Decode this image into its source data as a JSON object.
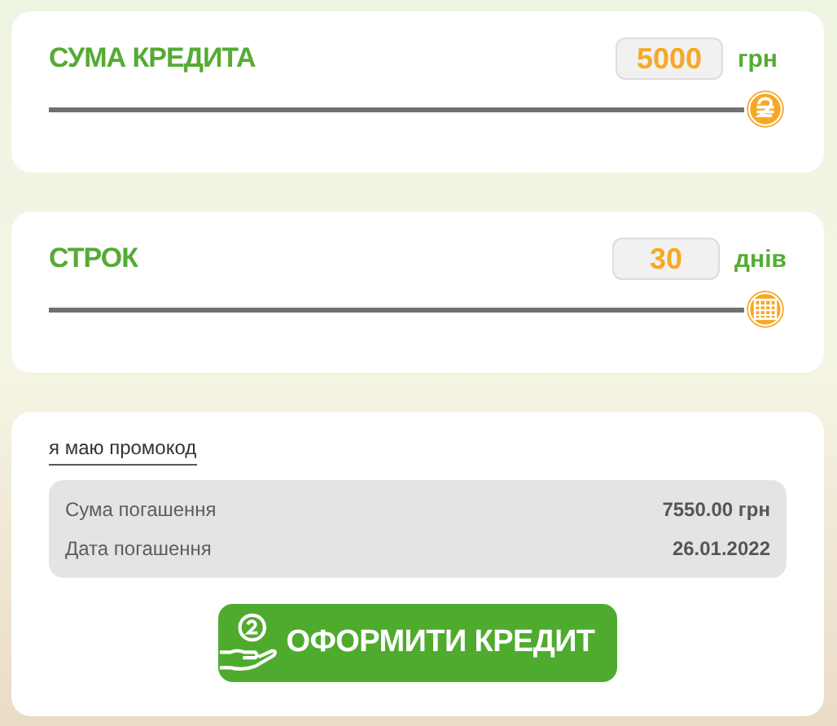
{
  "sliders": [
    {
      "kind": "amount",
      "label": "СУМА КРЕДИТА",
      "value": "5000",
      "unit": "грн",
      "level": 1
    },
    {
      "kind": "term",
      "label": "СТРОК",
      "value": "30",
      "unit": "днів",
      "level": 1
    }
  ],
  "promo_link": "я маю промокод",
  "summary": [
    {
      "label": "Сума погашення",
      "value": "7550.00 грн"
    },
    {
      "label": "Дата погашення",
      "value": "26.01.2022"
    }
  ],
  "submit_button": "ОФОРМИТИ КРЕДИТ"
}
